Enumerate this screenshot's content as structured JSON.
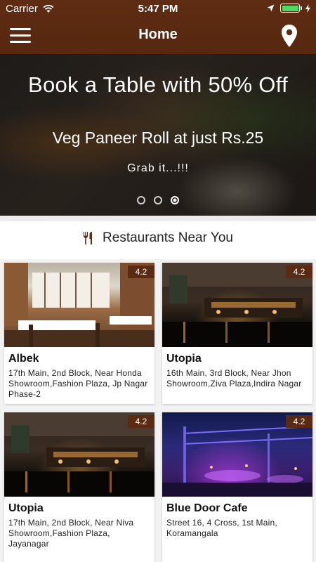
{
  "status_bar": {
    "carrier": "Carrier",
    "time": "5:47 PM"
  },
  "nav": {
    "title": "Home",
    "left_icon": "hamburger-menu-icon",
    "right_icon": "location-pin-icon"
  },
  "banner": {
    "headline": "Book a Table with 50% Off",
    "offer": "Veg Paneer Roll at just Rs.25",
    "tagline": "Grab it...!!!",
    "slide_count": 3,
    "active_slide": 3
  },
  "section": {
    "icon": "fork-knife-icon",
    "title": "Restaurants Near You"
  },
  "restaurants": [
    {
      "name": "Albek",
      "rating": "4.2",
      "address": "17th Main, 2nd Block, Near Honda Showroom,Fashion Plaza, Jp Nagar Phase-2"
    },
    {
      "name": "Utopia",
      "rating": "4.2",
      "address": "16th Main, 3rd Block, Near Jhon Showroom,Ziva Plaza,Indira Nagar"
    },
    {
      "name": "Utopia",
      "rating": "4.2",
      "address": "17th Main, 2nd Block, Near Niva Showroom,Fashion Plaza, Jayanagar"
    },
    {
      "name": "Blue Door Cafe",
      "rating": "4.2",
      "address": "Street 16, 4 Cross, 1st Main, Koramangala"
    }
  ],
  "colors": {
    "brand": "#5a2a12",
    "battery": "#4cd964"
  }
}
